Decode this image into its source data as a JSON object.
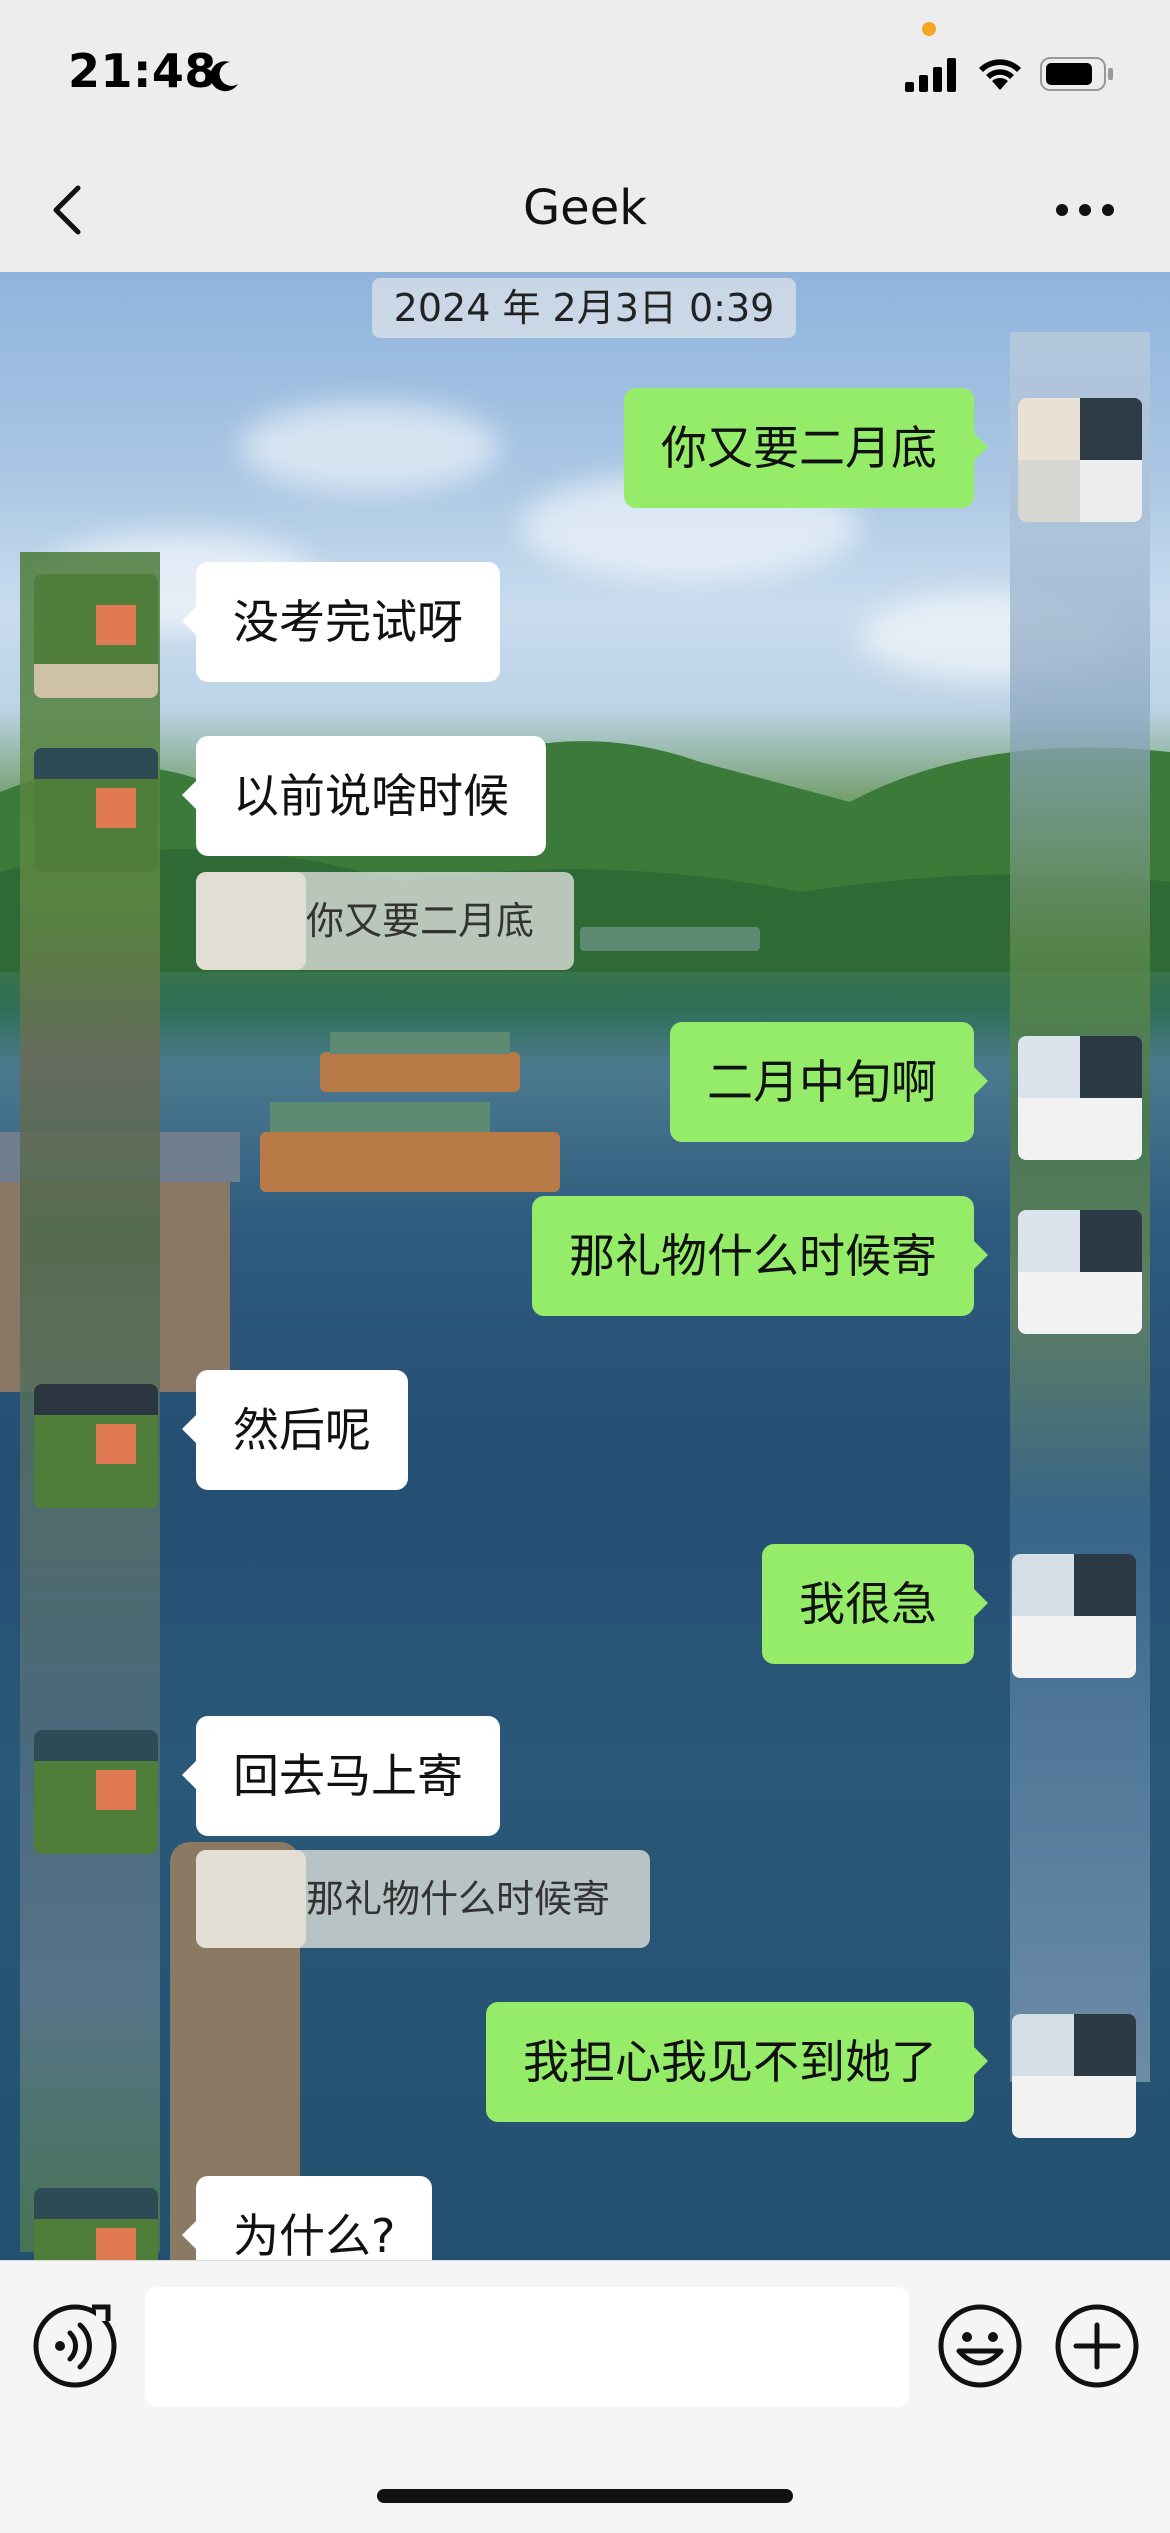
{
  "status_bar": {
    "time": "21:48",
    "icons": [
      "moon-icon",
      "signal-icon",
      "wifi-icon",
      "battery-icon"
    ]
  },
  "nav": {
    "title": "Geek",
    "back_icon": "chevron-left-icon",
    "more_icon": "more-dots-icon"
  },
  "chat": {
    "timestamp": "2024 年 2月3日 0:39",
    "messages": [
      {
        "side": "right",
        "text": "你又要二月底"
      },
      {
        "side": "left",
        "text": "没考完试呀"
      },
      {
        "side": "left",
        "text": "以前说啥时候",
        "quote": "你又要二月底"
      },
      {
        "side": "right",
        "text": "二月中旬啊"
      },
      {
        "side": "right",
        "text": "那礼物什么时候寄"
      },
      {
        "side": "left",
        "text": "然后呢"
      },
      {
        "side": "right",
        "text": "我很急"
      },
      {
        "side": "left",
        "text": "回去马上寄",
        "quote": "那礼物什么时候寄"
      },
      {
        "side": "right",
        "text": "我担心我见不到她了"
      },
      {
        "side": "left",
        "text": "为什么?"
      }
    ]
  },
  "input_bar": {
    "voice_icon": "voice-icon",
    "emoji_icon": "emoji-icon",
    "plus_icon": "plus-icon",
    "placeholder": ""
  },
  "colors": {
    "sent_bubble": "#95ec69",
    "received_bubble": "#ffffff",
    "background": "#ededed"
  }
}
